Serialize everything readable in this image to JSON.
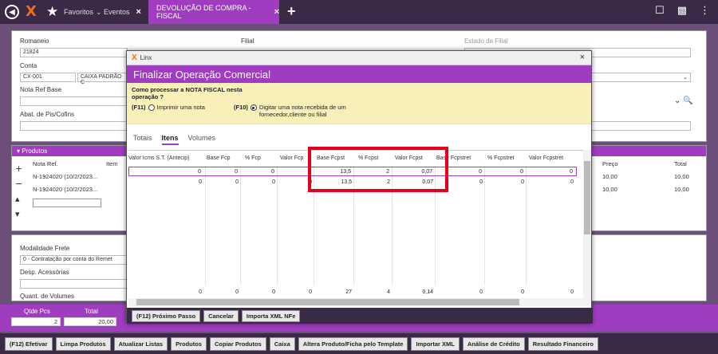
{
  "topbar": {
    "tabs": [
      {
        "label": "Favoritos"
      },
      {
        "label": "Eventos"
      },
      {
        "label": "DEVOLUÇÃO DE COMPRA - FISCAL"
      }
    ],
    "close_glyph": "×"
  },
  "form": {
    "romaneio_label": "Romaneio",
    "romaneio_value": "21824",
    "filial_label": "Filial",
    "estado_label": "Estado da Filial",
    "conta_label": "Conta",
    "conta_value": "CX-001",
    "conta_desc": "CAIXA PADRÃO C",
    "nota_ref_label": "Nota Ref Base",
    "abat_label": "Abat. de Pis/Cofins"
  },
  "produtos": {
    "header": "Produtos",
    "col_nota": "Nota Ref.",
    "col_item": "Item",
    "rows": [
      "N-1924020 (10/2/2023...",
      "N-1924020 (10/2/2023..."
    ],
    "col_preco": "Preço",
    "col_total": "Total",
    "preco_rows": [
      "10,00",
      "10,00"
    ],
    "total_rows": [
      "10,00",
      "10,00"
    ]
  },
  "frete": {
    "label": "Modalidade Frete",
    "value": "0 - Contratação por conta do Remet",
    "desp_label": "Desp. Acessórias",
    "volumes_label": "Quant. de Volumes"
  },
  "totals": {
    "qtde_label": "Qtde Pcs",
    "qtde_value": "2",
    "total_label": "Total",
    "total_value": "20,00"
  },
  "buttons": [
    "(F12) Efetivar",
    "Limpa Produtos",
    "Atualizar Listas",
    "Produtos",
    "Copiar Produtos",
    "Caixa",
    "Altera Produto/Ficha pelo Template",
    "Importar XML",
    "Análise de Crédito",
    "Resultado Financeiro"
  ],
  "modal": {
    "window_title": "Linx",
    "title": "Finalizar Operação Comercial",
    "question": "Como processar a NOTA FISCAL nesta operação ?",
    "opt1_key": "(F11)",
    "opt1_label": "Imprimir uma nota",
    "opt2_key": "(F10)",
    "opt2_label": "Digitar uma nota recebida de um fornecedor,cliente ou filial",
    "tabs": [
      "Totais",
      "Itens",
      "Volumes"
    ],
    "columns": [
      "Valor Icms S.T. (Antecip)",
      "Base Fcp",
      "% Fcp",
      "Valor Fcp",
      "Base Fcpst",
      "% Fcpst",
      "Valor Fcpst",
      "Base Fcpstret",
      "% Fcpstret",
      "Valor Fcpstret"
    ],
    "rows": [
      [
        "0",
        "0",
        "0",
        "0",
        "13,5",
        "2",
        "0,07",
        "0",
        "0",
        "0"
      ],
      [
        "0",
        "0",
        "0",
        "0",
        "13,5",
        "2",
        "0,07",
        "0",
        "0",
        "0"
      ]
    ],
    "footer_row": [
      "0",
      "0",
      "0",
      "0",
      "27",
      "4",
      "0,14",
      "0",
      "0",
      "0"
    ],
    "footer_buttons": [
      "(F12) Próximo Passo",
      "Cancelar",
      "Importa XML NFe"
    ]
  }
}
